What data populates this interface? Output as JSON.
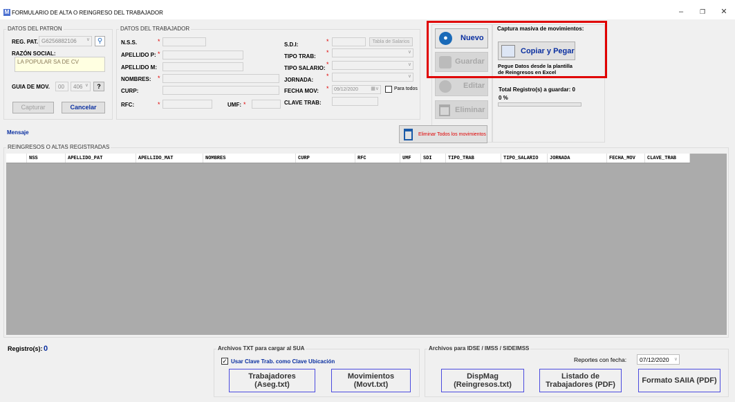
{
  "window": {
    "title": "FORMULARIO DE ALTA O REINGRESO DEL TRABAJADOR",
    "icon": "app-m-icon"
  },
  "patron": {
    "group": "DATOS DEL PATRON",
    "reg_pat_label": "REG. PAT.",
    "reg_pat_value": "G6256882106",
    "razon_label": "RAZÓN SOCIAL:",
    "razon_value": "LA POPULAR SA DE CV",
    "guia_label": "GUIA DE MOV.",
    "guia_a": "00",
    "guia_b": "406",
    "guia_btn": "?",
    "capturar": "Capturar",
    "cancelar": "Cancelar"
  },
  "trabajador": {
    "group": "DATOS DEL TRABAJADOR",
    "nss": "N.S.S.",
    "apellido_p": "APELLIDO P:",
    "apellido_m": "APELLIDO M:",
    "nombres": "NOMBRES:",
    "curp": "CURP:",
    "rfc": "RFC:",
    "umf": "UMF:",
    "sdi": "S.D.I:",
    "tabla_salarios": "Tabla de Salarios",
    "tipo_trab": "TIPO TRAB:",
    "tipo_salario": "TIPO SALARIO:",
    "jornada": "JORNADA:",
    "fecha_mov": "FECHA MOV:",
    "fecha_value": "09/12/2020",
    "para_todos": "Para todos",
    "clave_trab": "CLAVE TRAB:"
  },
  "actions": {
    "nuevo": "Nuevo",
    "guardar": "Guardar",
    "editar": "Editar",
    "eliminar": "Eliminar",
    "eliminar_todos": "Eliminar Todos los movimientos"
  },
  "captura": {
    "title": "Captura masiva de movimientos:",
    "copiar_pegar": "Copiar y Pegar",
    "desc1": "Pegue Datos desde la plantilla",
    "desc2": "de Reingresos en Excel",
    "total_label": "Total Registro(s) a guardar:",
    "total_value": "0",
    "progress_text": "0 %",
    "progress": 0
  },
  "mensaje": "Mensaje",
  "grid": {
    "label": "REINGRESOS O ALTAS REGISTRADAS",
    "columns": [
      "NSS",
      "APELLIDO_PAT",
      "APELLIDO_MAT",
      "NOMBRES",
      "CURP",
      "RFC",
      "UMF",
      "SDI",
      "TIPO_TRAB",
      "TIPO_SALARIO",
      "JORNADA",
      "FECHA_MOV",
      "CLAVE_TRAB"
    ]
  },
  "footer": {
    "registros_label": "Registro(s):",
    "registros_value": "0",
    "txt_group": "Archivos  TXT para cargar al SUA",
    "usar_clave": "Usar Clave Trab. como Clave Ubicación",
    "trabajadores": "Trabajadores",
    "trabajadores_sub": "(Aseg.txt)",
    "movimientos": "Movimientos",
    "movimientos_sub": "(Movt.txt)",
    "idse_group": "Archivos para IDSE / IMSS / SIDEIMSS",
    "reportes_label": "Reportes con fecha:",
    "reportes_value": "07/12/2020",
    "dispmag": "DispMag",
    "dispmag_sub": "(Reingresos.txt)",
    "listado": "Listado de",
    "listado_sub": "Trabajadores (PDF)",
    "formato": "Formato SAIIA (PDF)"
  },
  "colors": {
    "highlight": "#e00000",
    "accent_blue": "#0a2fa0",
    "grid_bg": "#ababab"
  }
}
